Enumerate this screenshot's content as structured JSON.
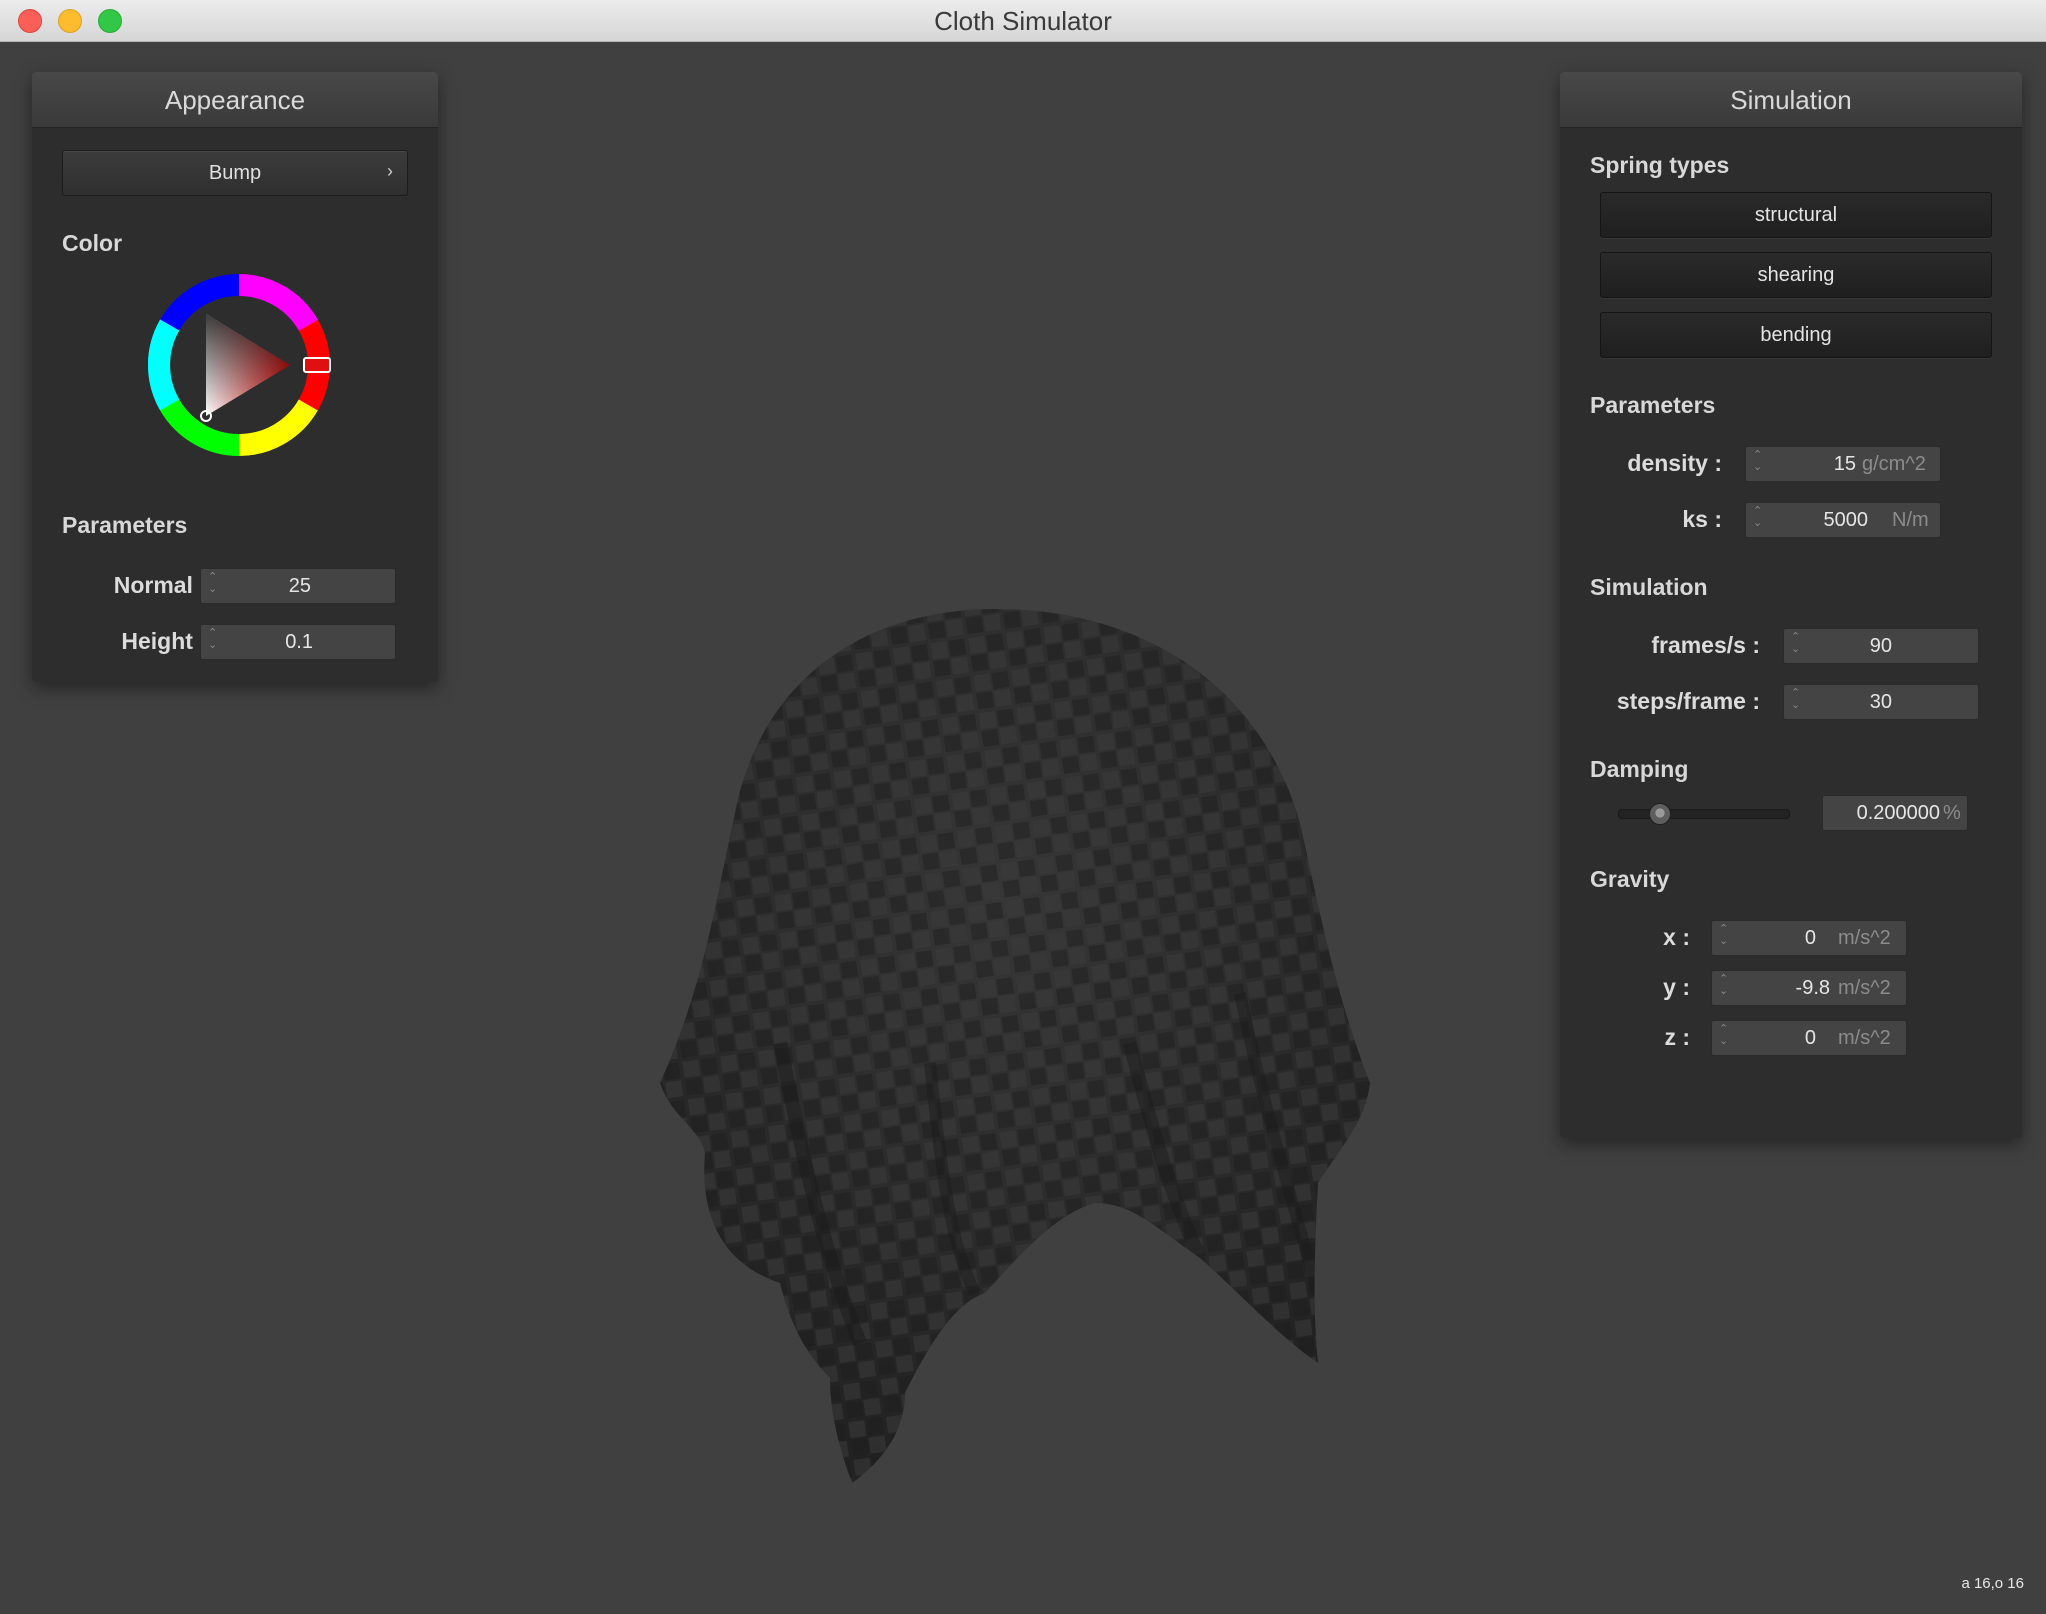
{
  "window": {
    "title": "Cloth Simulator"
  },
  "appearance": {
    "header": "Appearance",
    "shader_button": "Bump",
    "color_label": "Color",
    "selected_color": "#e01010",
    "parameters_label": "Parameters",
    "normal": {
      "label": "Normal :",
      "value": "25"
    },
    "height": {
      "label": "Height :",
      "value": "0.1"
    }
  },
  "simulation": {
    "header": "Simulation",
    "spring_types_label": "Spring types",
    "springs": [
      "structural",
      "shearing",
      "bending"
    ],
    "parameters_label": "Parameters",
    "density": {
      "label": "density :",
      "value": "15",
      "unit": "g/cm^2"
    },
    "ks": {
      "label": "ks :",
      "value": "5000",
      "unit": "N/m"
    },
    "simulation_label": "Simulation",
    "fps": {
      "label": "frames/s :",
      "value": "90"
    },
    "steps": {
      "label": "steps/frame :",
      "value": "30"
    },
    "damping_label": "Damping",
    "damping": {
      "value": "0.200000",
      "unit": "%",
      "slider_fraction": 0.2
    },
    "gravity_label": "Gravity",
    "gx": {
      "label": "x :",
      "value": "0",
      "unit": "m/s^2"
    },
    "gy": {
      "label": "y :",
      "value": "-9.8",
      "unit": "m/s^2"
    },
    "gz": {
      "label": "z :",
      "value": "0",
      "unit": "m/s^2"
    }
  },
  "status": {
    "corner_text": "a 16,o 16"
  },
  "icons": {
    "button_arrow": "chevron-right-icon",
    "spinner": "spinner-arrows-icon"
  }
}
